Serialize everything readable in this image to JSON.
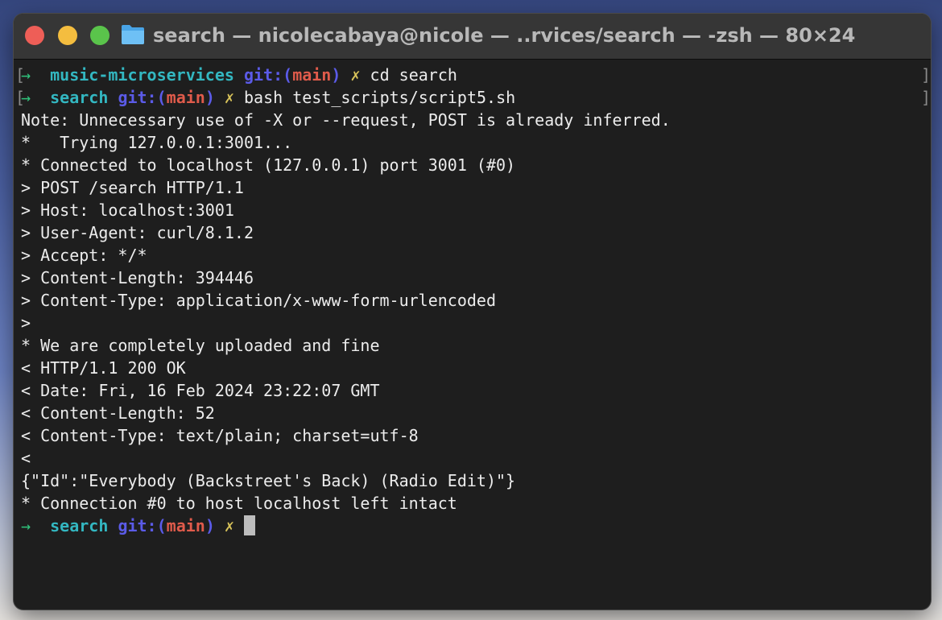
{
  "window": {
    "title": "search — nicolecabaya@nicole — ..rvices/search — -zsh — 80×24"
  },
  "prompts": [
    {
      "arrow": "→",
      "dir": "music-microservices",
      "git_label": "git:",
      "paren_open": "(",
      "branch": "main",
      "paren_close": ")",
      "dirty": "✗",
      "command": "cd search"
    },
    {
      "arrow": "→",
      "dir": "search",
      "git_label": "git:",
      "paren_open": "(",
      "branch": "main",
      "paren_close": ")",
      "dirty": "✗",
      "command": "bash test_scripts/script5.sh"
    }
  ],
  "output_lines": [
    "Note: Unnecessary use of -X or --request, POST is already inferred.",
    "*   Trying 127.0.0.1:3001...",
    "* Connected to localhost (127.0.0.1) port 3001 (#0)",
    "> POST /search HTTP/1.1",
    "> Host: localhost:3001",
    "> User-Agent: curl/8.1.2",
    "> Accept: */*",
    "> Content-Length: 394446",
    "> Content-Type: application/x-www-form-urlencoded",
    ">",
    "* We are completely uploaded and fine",
    "< HTTP/1.1 200 OK",
    "< Date: Fri, 16 Feb 2024 23:22:07 GMT",
    "< Content-Length: 52",
    "< Content-Type: text/plain; charset=utf-8",
    "<",
    "{\"Id\":\"Everybody (Backstreet's Back) (Radio Edit)\"}",
    "* Connection #0 to host localhost left intact"
  ],
  "current_prompt": {
    "arrow": "→",
    "dir": "search",
    "git_label": "git:",
    "paren_open": "(",
    "branch": "main",
    "paren_close": ")",
    "dirty": "✗"
  },
  "mark_open": "[",
  "mark_close": "]",
  "colors": {
    "background": "#1e1e1e",
    "arrow": "#30c47c",
    "directory": "#33b7c1",
    "git_label": "#5b5be8",
    "branch": "#e05b4b",
    "dirty": "#d8c35a",
    "text": "#ececec"
  }
}
